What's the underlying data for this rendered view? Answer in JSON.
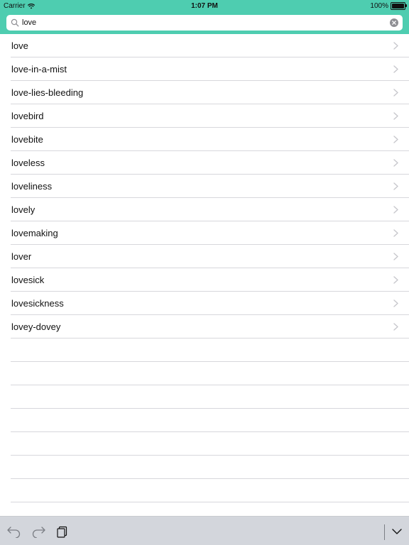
{
  "status_bar": {
    "carrier": "Carrier",
    "time": "1:07 PM",
    "battery": "100%"
  },
  "search": {
    "value": "love",
    "placeholder": ""
  },
  "results": [
    {
      "label": "love"
    },
    {
      "label": "love-in-a-mist"
    },
    {
      "label": "love-lies-bleeding"
    },
    {
      "label": "lovebird"
    },
    {
      "label": "lovebite"
    },
    {
      "label": "loveless"
    },
    {
      "label": "loveliness"
    },
    {
      "label": "lovely"
    },
    {
      "label": "lovemaking"
    },
    {
      "label": "lover"
    },
    {
      "label": "lovesick"
    },
    {
      "label": "lovesickness"
    },
    {
      "label": "lovey-dovey"
    }
  ],
  "toolbar": {
    "buttons": [
      "undo-icon",
      "redo-icon",
      "paste-icon",
      "chevron-down-icon"
    ]
  },
  "colors": {
    "header": "#4ECDB0",
    "toolbar": "#d3d6dc",
    "separator": "#d7d7dc",
    "chevron": "#c7c7cc"
  }
}
